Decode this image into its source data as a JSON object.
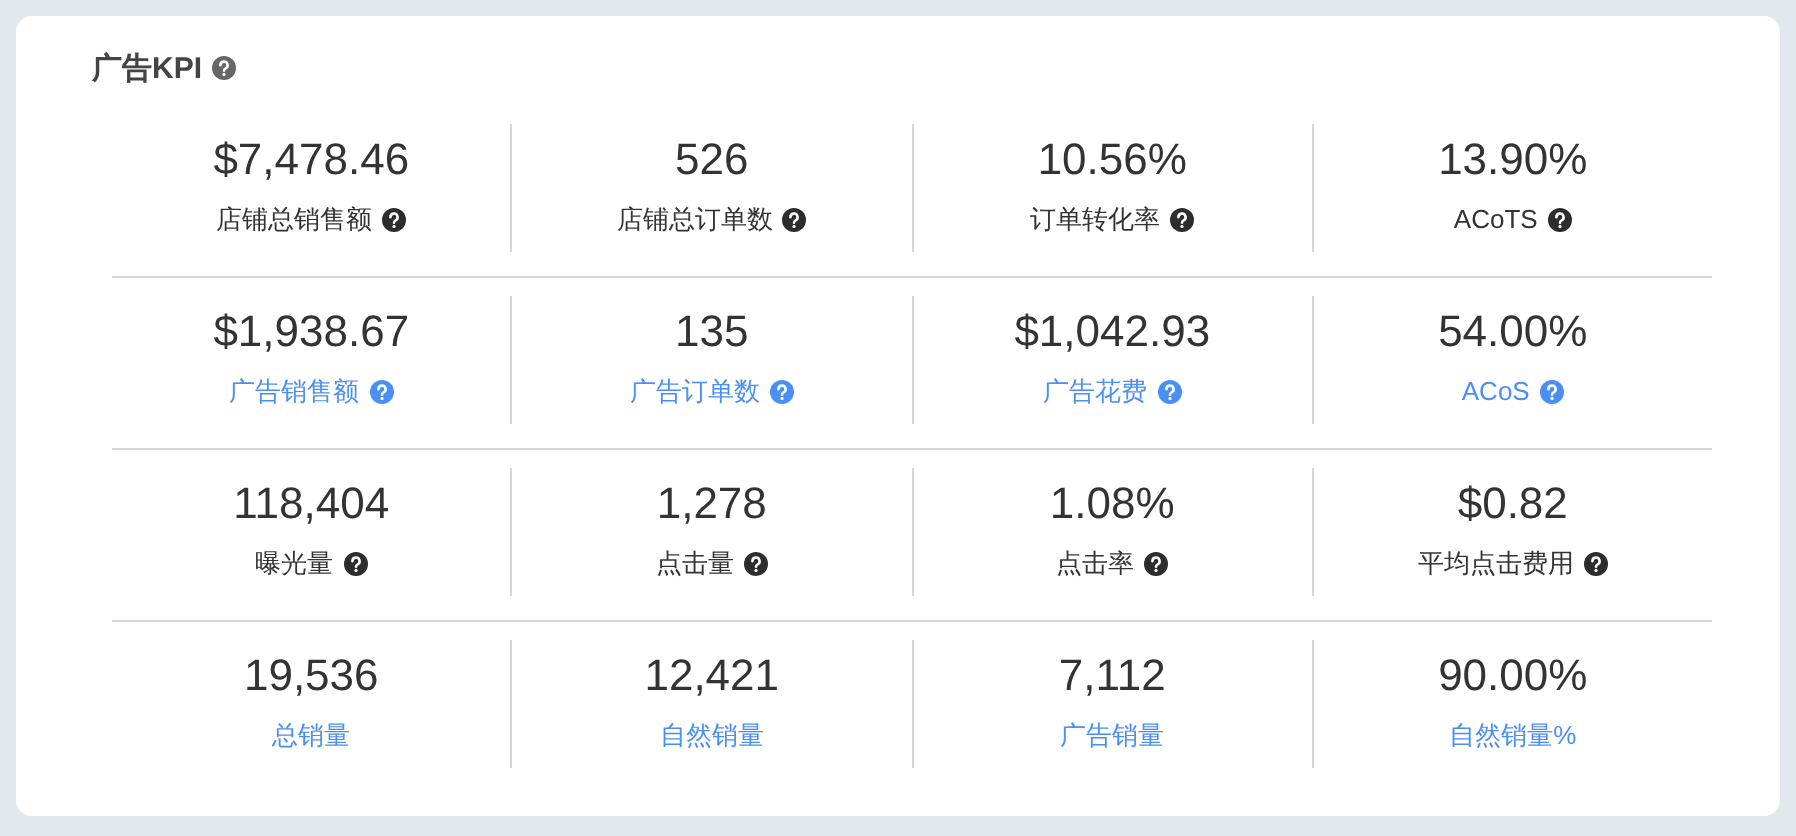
{
  "title": "广告KPI",
  "title_help": true,
  "rows": [
    [
      {
        "value": "$7,478.46",
        "label": "店铺总销售额",
        "kind": "plain",
        "help": true
      },
      {
        "value": "526",
        "label": "店铺总订单数",
        "kind": "plain",
        "help": true
      },
      {
        "value": "10.56%",
        "label": "订单转化率",
        "kind": "plain",
        "help": true
      },
      {
        "value": "13.90%",
        "label": "ACoTS",
        "kind": "plain",
        "help": true
      }
    ],
    [
      {
        "value": "$1,938.67",
        "label": "广告销售额",
        "kind": "link",
        "help": true
      },
      {
        "value": "135",
        "label": "广告订单数",
        "kind": "link",
        "help": true
      },
      {
        "value": "$1,042.93",
        "label": "广告花费",
        "kind": "link",
        "help": true
      },
      {
        "value": "54.00%",
        "label": "ACoS",
        "kind": "link",
        "help": true
      }
    ],
    [
      {
        "value": "118,404",
        "label": "曝光量",
        "kind": "plain",
        "help": true
      },
      {
        "value": "1,278",
        "label": "点击量",
        "kind": "plain",
        "help": true
      },
      {
        "value": "1.08%",
        "label": "点击率",
        "kind": "plain",
        "help": true
      },
      {
        "value": "$0.82",
        "label": "平均点击费用",
        "kind": "plain",
        "help": true
      }
    ],
    [
      {
        "value": "19,536",
        "label": "总销量",
        "kind": "link",
        "help": false
      },
      {
        "value": "12,421",
        "label": "自然销量",
        "kind": "link",
        "help": false
      },
      {
        "value": "7,112",
        "label": "广告销量",
        "kind": "link",
        "help": false
      },
      {
        "value": "90.00%",
        "label": "自然销量%",
        "kind": "link",
        "help": false
      }
    ]
  ]
}
